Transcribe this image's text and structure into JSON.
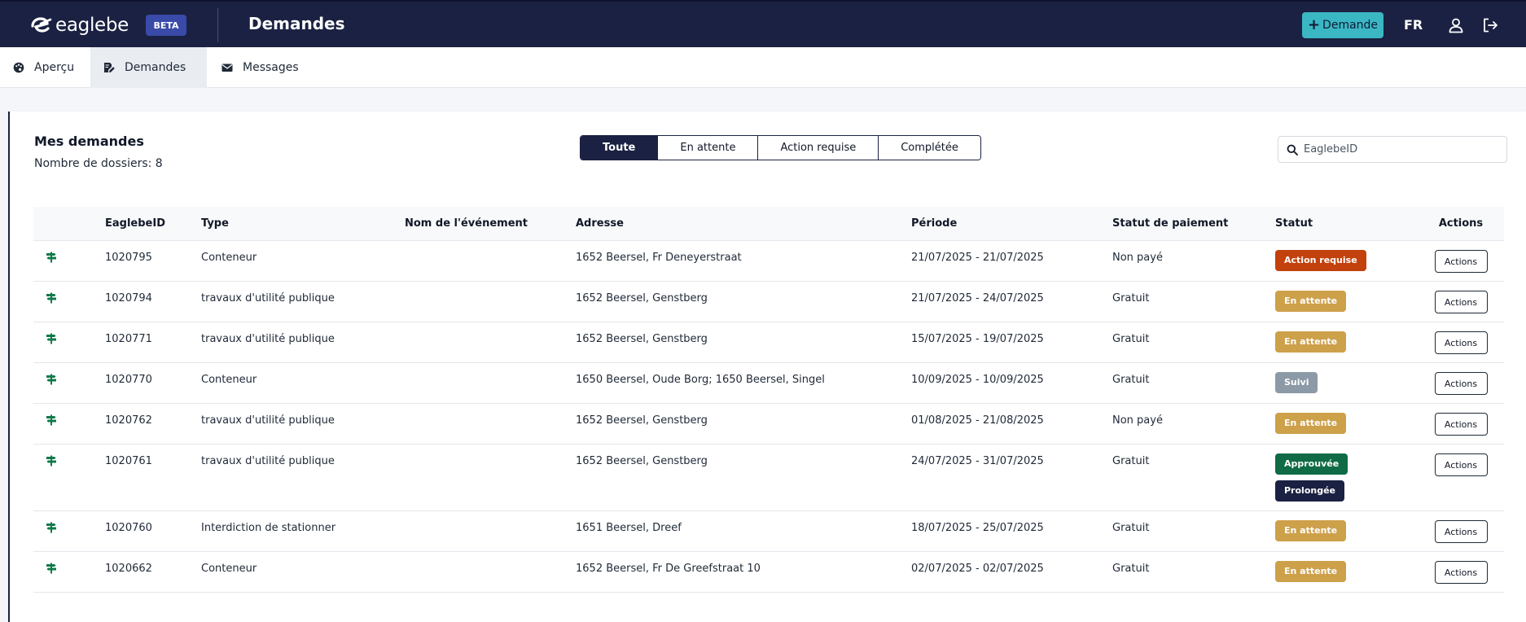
{
  "header": {
    "brand": "eaglebe",
    "beta_label": "BETA",
    "page_title": "Demandes",
    "add_button_label": "Demande",
    "language": "FR"
  },
  "nav": {
    "items": [
      {
        "label": "Aperçu",
        "icon": "palette-icon"
      },
      {
        "label": "Demandes",
        "icon": "edit-document-icon"
      },
      {
        "label": "Messages",
        "icon": "envelope-icon"
      }
    ]
  },
  "card": {
    "title": "Mes demandes",
    "subtitle": "Nombre de dossiers: 8"
  },
  "filters": [
    "Toute",
    "En attente",
    "Action requise",
    "Complétée"
  ],
  "search": {
    "placeholder": "EaglebeID"
  },
  "table": {
    "headers": {
      "id": "EaglebeID",
      "type": "Type",
      "event": "Nom de l'événement",
      "address": "Adresse",
      "period": "Période",
      "payment": "Statut de paiement",
      "status": "Statut",
      "actions": "Actions"
    },
    "rows": [
      {
        "id": "1020795",
        "type": "Conteneur",
        "event": "",
        "address": "1652 Beersel, Fr Deneyerstraat",
        "period": "21/07/2025 - 21/07/2025",
        "payment": "Non payé",
        "statuses": [
          {
            "label": "Action requise",
            "color": "#c2410c"
          }
        ],
        "action": "Actions"
      },
      {
        "id": "1020794",
        "type": "travaux d'utilité publique",
        "event": "",
        "address": "1652 Beersel, Genstberg",
        "period": "21/07/2025 - 24/07/2025",
        "payment": "Gratuit",
        "statuses": [
          {
            "label": "En attente",
            "color": "#cda04a"
          }
        ],
        "action": "Actions"
      },
      {
        "id": "1020771",
        "type": "travaux d'utilité publique",
        "event": "",
        "address": "1652 Beersel, Genstberg",
        "period": "15/07/2025 - 19/07/2025",
        "payment": "Gratuit",
        "statuses": [
          {
            "label": "En attente",
            "color": "#cda04a"
          }
        ],
        "action": "Actions"
      },
      {
        "id": "1020770",
        "type": "Conteneur",
        "event": "",
        "address": "1650 Beersel, Oude Borg; 1650 Beersel, Singel",
        "period": "10/09/2025 - 10/09/2025",
        "payment": "Gratuit",
        "statuses": [
          {
            "label": "Suivi",
            "color": "#8c99a6"
          }
        ],
        "action": "Actions"
      },
      {
        "id": "1020762",
        "type": "travaux d'utilité publique",
        "event": "",
        "address": "1652 Beersel, Genstberg",
        "period": "01/08/2025 - 21/08/2025",
        "payment": "Non payé",
        "statuses": [
          {
            "label": "En attente",
            "color": "#cda04a"
          }
        ],
        "action": "Actions"
      },
      {
        "id": "1020761",
        "type": "travaux d'utilité publique",
        "event": "",
        "address": "1652 Beersel, Genstberg",
        "period": "24/07/2025 - 31/07/2025",
        "payment": "Gratuit",
        "statuses": [
          {
            "label": "Approuvée",
            "color": "#0f6b45"
          },
          {
            "label": "Prolongée",
            "color": "#1b2142"
          }
        ],
        "action": "Actions"
      },
      {
        "id": "1020760",
        "type": "Interdiction de stationner",
        "event": "",
        "address": "1651 Beersel, Dreef",
        "period": "18/07/2025 - 25/07/2025",
        "payment": "Gratuit",
        "statuses": [
          {
            "label": "En attente",
            "color": "#cda04a"
          }
        ],
        "action": "Actions"
      },
      {
        "id": "1020662",
        "type": "Conteneur",
        "event": "",
        "address": "1652 Beersel, Fr De Greefstraat 10",
        "period": "02/07/2025 - 02/07/2025",
        "payment": "Gratuit",
        "statuses": [
          {
            "label": "En attente",
            "color": "#cda04a"
          }
        ],
        "action": "Actions"
      }
    ]
  },
  "colors": {
    "topbar": "#1b2142",
    "accent": "#3bb7c4",
    "sign_icon": "#0f7a4a"
  }
}
